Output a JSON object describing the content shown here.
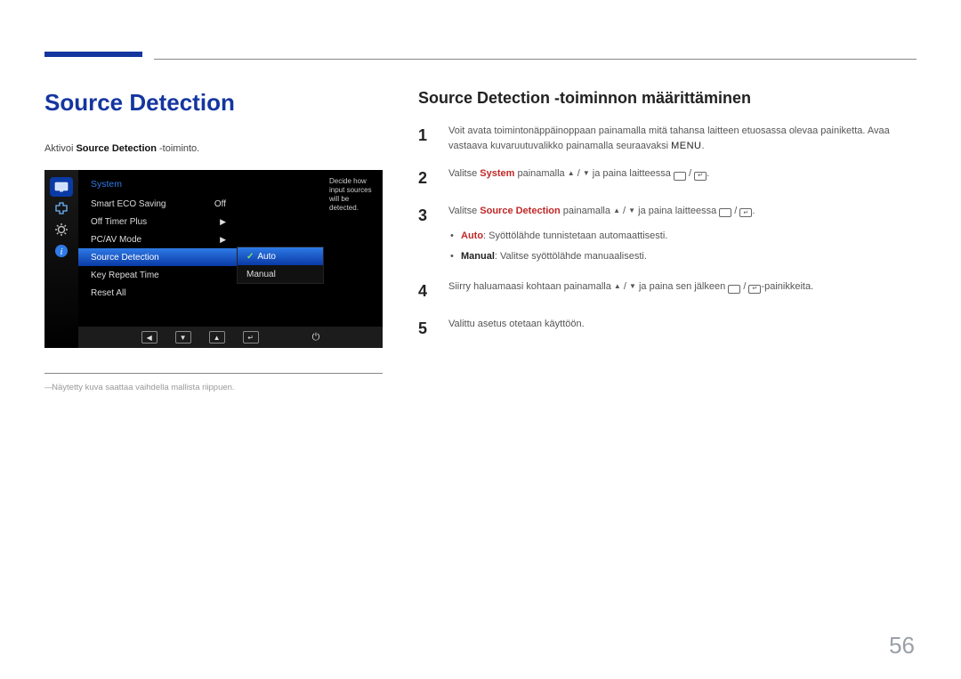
{
  "page": {
    "title": "Source Detection",
    "activate_prefix": "Aktivoi ",
    "activate_bold": "Source Detection",
    "activate_suffix": " -toiminto.",
    "note": "Näytetty kuva saattaa vaihdella mallista riippuen.",
    "number": "56"
  },
  "osd": {
    "heading": "System",
    "rows": [
      {
        "label": "Smart ECO Saving",
        "value": "Off"
      },
      {
        "label": "Off Timer Plus",
        "value": "▶"
      },
      {
        "label": "PC/AV Mode",
        "value": "▶"
      },
      {
        "label": "Source Detection",
        "value": ""
      },
      {
        "label": "Key Repeat Time",
        "value": ""
      },
      {
        "label": "Reset All",
        "value": ""
      }
    ],
    "selected_index": 3,
    "sub": {
      "options": [
        "Auto",
        "Manual"
      ],
      "selected_index": 0
    },
    "help": "Decide how input sources will be detected.",
    "nav_glyphs": {
      "left": "◀",
      "down": "▼",
      "up": "▲",
      "enter": "↵"
    }
  },
  "section": {
    "heading": "Source Detection -toiminnon määrittäminen",
    "menu_word": "MENU",
    "steps": {
      "s1a": "Voit avata toimintonäppäinoppaan painamalla mitä tahansa laitteen etuosassa olevaa painiketta. Avaa vastaava kuvaruutuvalikko painamalla seuraavaksi ",
      "s1b": ".",
      "s2a": "Valitse ",
      "s2_system": "System",
      "s2b": " painamalla ",
      "s2c": " ja paina laitteessa ",
      "s2d": ".",
      "s3a": "Valitse ",
      "s3_sd": "Source Detection",
      "s3b": " painamalla ",
      "s3c": " ja paina laitteessa ",
      "s3d": ".",
      "bullet_auto_label": "Auto",
      "bullet_auto_text": ": Syöttölähde tunnistetaan automaattisesti.",
      "bullet_manual_label": "Manual",
      "bullet_manual_text": ": Valitse syöttölähde manuaalisesti.",
      "s4a": "Siirry haluamaasi kohtaan painamalla ",
      "s4b": " ja paina sen jälkeen ",
      "s4c": "-painikkeita.",
      "s5": "Valittu asetus otetaan käyttöön.",
      "slash": " / ",
      "tri_up": "▲",
      "tri_down": "▼"
    }
  }
}
